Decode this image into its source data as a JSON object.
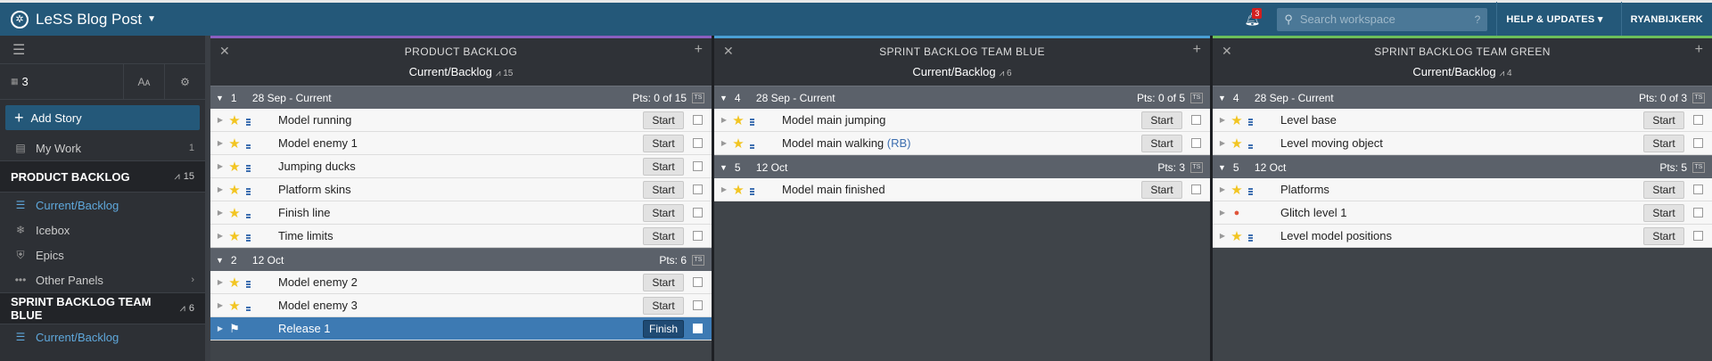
{
  "header": {
    "project_title": "LeSS Blog Post",
    "notifications_count": "3",
    "search_placeholder": "Search workspace",
    "search_help": "?",
    "help_label": "HELP & UPDATES",
    "user_label": "RYANBIJKERK"
  },
  "sidebar": {
    "story_count": "3",
    "font_label": "Aᴀ",
    "add_story": "Add Story",
    "my_work": {
      "label": "My Work",
      "count": "1"
    },
    "sections": [
      {
        "title": "PRODUCT BACKLOG",
        "velocity": "15",
        "items": [
          {
            "label": "Current/Backlog",
            "icon": "list-icon"
          },
          {
            "label": "Icebox",
            "icon": "snowflake-icon"
          },
          {
            "label": "Epics",
            "icon": "shield-icon"
          },
          {
            "label": "Other Panels",
            "icon": "dots-icon"
          }
        ]
      },
      {
        "title": "SPRINT BACKLOG TEAM BLUE",
        "velocity": "6",
        "items": [
          {
            "label": "Current/Backlog",
            "icon": "list-icon"
          }
        ]
      }
    ]
  },
  "panels": [
    {
      "title": "PRODUCT BACKLOG",
      "subtitle": "Current/Backlog",
      "velocity": "15",
      "accent": "#8b5fbf",
      "iterations": [
        {
          "number": "1",
          "date": "28 Sep - Current",
          "points": "Pts: 0 of 15",
          "stories": [
            {
              "name": "Model running",
              "button": "Start",
              "type": "feature"
            },
            {
              "name": "Model enemy 1",
              "button": "Start",
              "type": "feature"
            },
            {
              "name": "Jumping ducks",
              "button": "Start",
              "type": "feature"
            },
            {
              "name": "Platform skins",
              "button": "Start",
              "type": "feature"
            },
            {
              "name": "Finish line",
              "button": "Start",
              "type": "feature"
            },
            {
              "name": "Time limits",
              "button": "Start",
              "type": "feature"
            }
          ]
        },
        {
          "number": "2",
          "date": "12 Oct",
          "points": "Pts: 6",
          "stories": [
            {
              "name": "Model enemy 2",
              "button": "Start",
              "type": "feature"
            },
            {
              "name": "Model enemy 3",
              "button": "Start",
              "type": "feature"
            },
            {
              "name": "Release 1",
              "button": "Finish",
              "type": "release"
            }
          ]
        }
      ]
    },
    {
      "title": "SPRINT BACKLOG TEAM BLUE",
      "subtitle": "Current/Backlog",
      "velocity": "6",
      "accent": "#4a9fd4",
      "iterations": [
        {
          "number": "4",
          "date": "28 Sep - Current",
          "points": "Pts: 0 of 5",
          "stories": [
            {
              "name": "Model main jumping",
              "button": "Start",
              "type": "feature"
            },
            {
              "name": "Model main walking",
              "label": "(RB)",
              "button": "Start",
              "type": "feature"
            }
          ]
        },
        {
          "number": "5",
          "date": "12 Oct",
          "points": "Pts: 3",
          "stories": [
            {
              "name": "Model main finished",
              "button": "Start",
              "type": "feature"
            }
          ]
        }
      ]
    },
    {
      "title": "SPRINT BACKLOG TEAM GREEN",
      "subtitle": "Current/Backlog",
      "velocity": "4",
      "accent": "#6cbf5a",
      "iterations": [
        {
          "number": "4",
          "date": "28 Sep - Current",
          "points": "Pts: 0 of 3",
          "stories": [
            {
              "name": "Level base",
              "button": "Start",
              "type": "feature"
            },
            {
              "name": "Level moving object",
              "button": "Start",
              "type": "feature"
            }
          ]
        },
        {
          "number": "5",
          "date": "12 Oct",
          "points": "Pts: 5",
          "stories": [
            {
              "name": "Platforms",
              "button": "Start",
              "type": "feature"
            },
            {
              "name": "Glitch level 1",
              "button": "Start",
              "type": "bug"
            },
            {
              "name": "Level model positions",
              "button": "Start",
              "type": "feature"
            }
          ]
        }
      ]
    }
  ]
}
